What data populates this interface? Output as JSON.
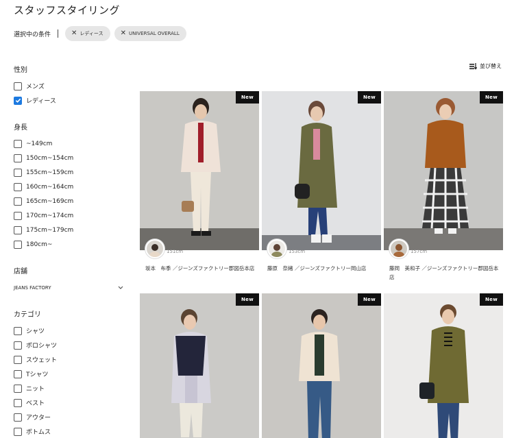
{
  "page": {
    "title": "スタッフスタイリング"
  },
  "conditions": {
    "label": "選択中の条件",
    "chips": [
      "レディース",
      "UNIVERSAL OVERALL"
    ]
  },
  "sort": {
    "label": "並び替え"
  },
  "filters": {
    "gender": {
      "title": "性別",
      "options": [
        {
          "label": "メンズ",
          "checked": false
        },
        {
          "label": "レディース",
          "checked": true
        }
      ]
    },
    "height": {
      "title": "身長",
      "options": [
        {
          "label": "~149cm",
          "checked": false
        },
        {
          "label": "150cm~154cm",
          "checked": false
        },
        {
          "label": "155cm~159cm",
          "checked": false
        },
        {
          "label": "160cm~164cm",
          "checked": false
        },
        {
          "label": "165cm~169cm",
          "checked": false
        },
        {
          "label": "170cm~174cm",
          "checked": false
        },
        {
          "label": "175cm~179cm",
          "checked": false
        },
        {
          "label": "180cm~",
          "checked": false
        }
      ]
    },
    "store": {
      "title": "店舗",
      "selected": "JEANS FACTORY"
    },
    "category": {
      "title": "カテゴリ",
      "options": [
        {
          "label": "シャツ",
          "checked": false
        },
        {
          "label": "ポロシャツ",
          "checked": false
        },
        {
          "label": "スウェット",
          "checked": false
        },
        {
          "label": "Tシャツ",
          "checked": false
        },
        {
          "label": "ニット",
          "checked": false
        },
        {
          "label": "ベスト",
          "checked": false
        },
        {
          "label": "アウター",
          "checked": false
        },
        {
          "label": "ボトムス",
          "checked": false
        }
      ]
    }
  },
  "cards": [
    {
      "badge": "New",
      "height": "151cm",
      "name": "坂本　布季 ／ジーンズファクトリー郡図岳本店"
    },
    {
      "badge": "New",
      "height": "153cm",
      "name": "藤原　奈緒 ／ジーンズファクトリー岡山店"
    },
    {
      "badge": "New",
      "height": "157cm",
      "name": "藤岡　美和子 ／ジーンズファクトリー郡図岳本店"
    },
    {
      "badge": "New"
    },
    {
      "badge": "New"
    },
    {
      "badge": "New"
    }
  ],
  "colors": {
    "accent": "#1d7ae0",
    "chip_bg": "#e6e6e6",
    "badge_bg": "#111111"
  }
}
